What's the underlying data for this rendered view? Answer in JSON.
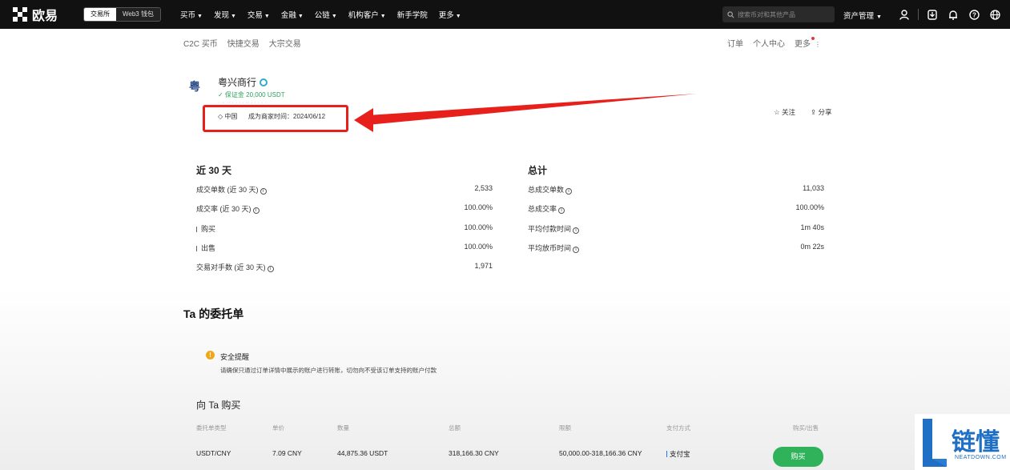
{
  "nav": {
    "brand": "欧易",
    "mode_exchange": "交易所",
    "mode_web3": "Web3 钱包",
    "items": [
      "买币",
      "发现",
      "交易",
      "金融",
      "公链",
      "机构客户",
      "新手学院",
      "更多"
    ],
    "search_placeholder": "搜索币对和其他产品",
    "asset_mgmt": "资产管理"
  },
  "subnav": {
    "left": [
      "C2C 买币",
      "快捷交易",
      "大宗交易"
    ],
    "right": [
      "订单",
      "个人中心",
      "更多"
    ]
  },
  "merchant": {
    "avatar_char": "粤",
    "name": "粤兴商行",
    "deposit": "✓ 保证金 20,000 USDT",
    "region": "中国",
    "since_label": "成为商家时间：2024/06/12",
    "follow": "关注",
    "share": "分享"
  },
  "stats30": {
    "title": "近 30 天",
    "rows": [
      {
        "label": "成交单数 (近 30 天)",
        "value": "2,533",
        "info": true,
        "bar": false
      },
      {
        "label": "成交率 (近 30 天)",
        "value": "100.00%",
        "info": true,
        "bar": false
      },
      {
        "label": "购买",
        "value": "100.00%",
        "info": false,
        "bar": true
      },
      {
        "label": "出售",
        "value": "100.00%",
        "info": false,
        "bar": true
      },
      {
        "label": "交易对手数 (近 30 天)",
        "value": "1,971",
        "info": true,
        "bar": false
      }
    ]
  },
  "statsTotal": {
    "title": "总计",
    "rows": [
      {
        "label": "总成交单数",
        "value": "11,033"
      },
      {
        "label": "总成交率",
        "value": "100.00%"
      },
      {
        "label": "平均付款时间",
        "value": "1m 40s"
      },
      {
        "label": "平均放币时间",
        "value": "0m 22s"
      }
    ]
  },
  "orders": {
    "title": "Ta 的委托单",
    "tip_title": "安全提醒",
    "tip_text": "请确保只通过订单详情中展示的账户进行转账，切勿向不受该订单支持的账户付款",
    "buy_title": "向 Ta 购买",
    "headers": [
      "委托单类型",
      "单价",
      "数量",
      "总额",
      "限额",
      "支付方式",
      "购买/出售"
    ],
    "row": {
      "pair": "USDT/CNY",
      "price": "7.09 CNY",
      "amount": "44,875.36 USDT",
      "total": "318,166.30 CNY",
      "limit": "50,000.00-318,166.36 CNY",
      "payment": "支付宝",
      "action": "购买"
    }
  },
  "watermark": {
    "text": "链懂",
    "sub": "NEATDOWN.COM"
  },
  "colors": {
    "highlight": "#e8201b",
    "buy": "#2fb25a",
    "verified": "#2aa35a",
    "watermark": "#1f6fc4"
  }
}
